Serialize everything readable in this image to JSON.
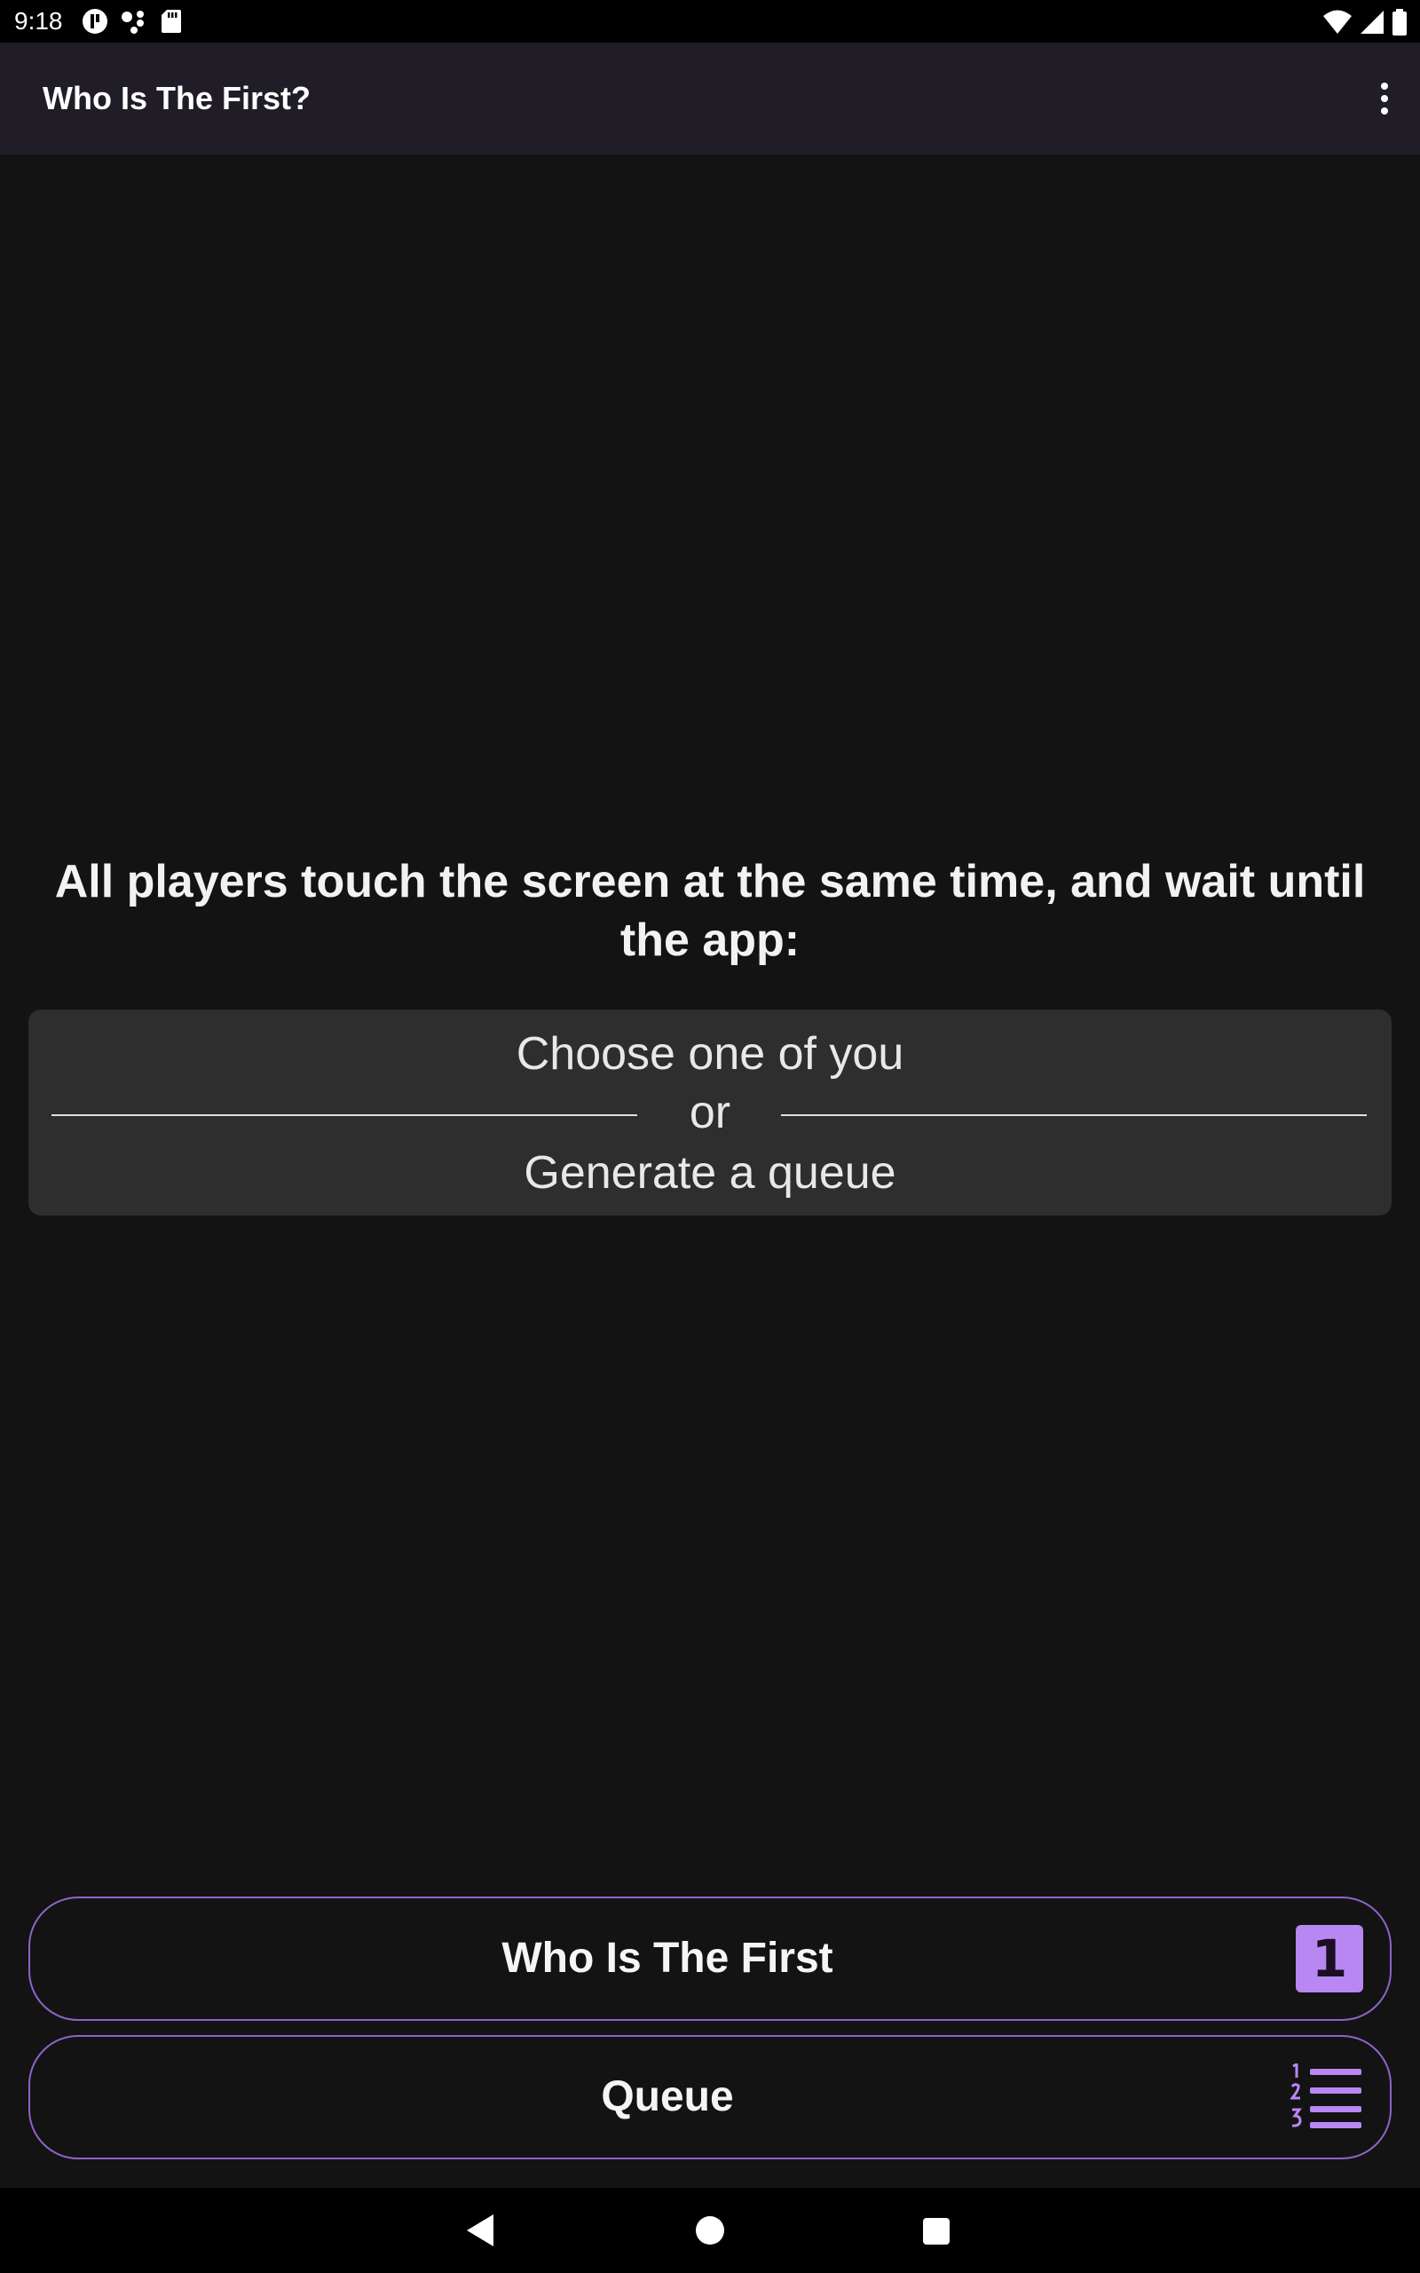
{
  "status_bar": {
    "time": "9:18",
    "left_icons": [
      "notification-app-icon",
      "dots-network-icon",
      "sd-card-icon"
    ],
    "right_icons": [
      "wifi-icon",
      "signal-icon",
      "battery-icon"
    ]
  },
  "app_bar": {
    "title": "Who Is The First?",
    "menu_icon": "more-vert-icon"
  },
  "main": {
    "instruction": "All players touch the screen at the same time, and wait until the app:",
    "choice_one": "Choose one of you",
    "choice_or": "or",
    "choice_two": "Generate a queue"
  },
  "actions": {
    "first_label": "Who Is The First",
    "first_icon_text": "1",
    "queue_label": "Queue",
    "queue_icon": "numbered-list-icon"
  },
  "colors": {
    "background": "#131313",
    "app_bar": "#211d27",
    "accent": "#b887f2",
    "button_border": "#8e63c9",
    "card": "#2e2e2e"
  },
  "nav_bar": {
    "icons": [
      "back-icon",
      "home-icon",
      "recents-icon"
    ]
  }
}
